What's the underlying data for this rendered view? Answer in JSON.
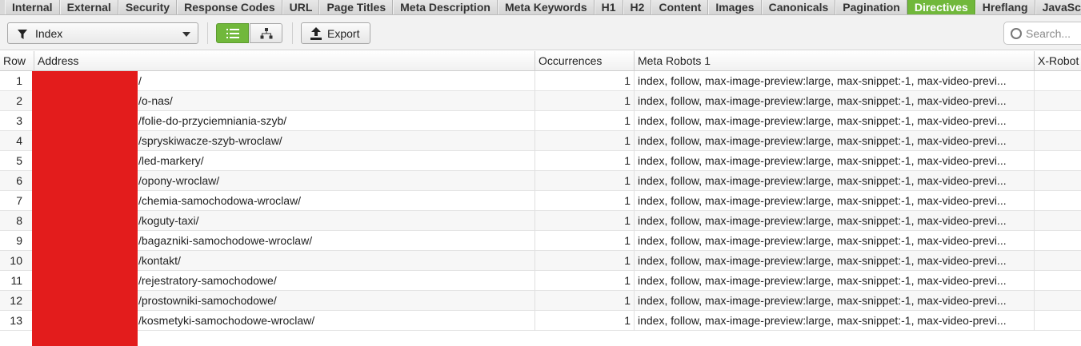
{
  "tabs": [
    {
      "label": "Internal"
    },
    {
      "label": "External"
    },
    {
      "label": "Security"
    },
    {
      "label": "Response Codes"
    },
    {
      "label": "URL"
    },
    {
      "label": "Page Titles"
    },
    {
      "label": "Meta Description"
    },
    {
      "label": "Meta Keywords"
    },
    {
      "label": "H1"
    },
    {
      "label": "H2"
    },
    {
      "label": "Content"
    },
    {
      "label": "Images"
    },
    {
      "label": "Canonicals"
    },
    {
      "label": "Pagination"
    },
    {
      "label": "Directives",
      "active": true
    },
    {
      "label": "Hreflang"
    },
    {
      "label": "JavaScri"
    }
  ],
  "toolbar": {
    "filter": {
      "value": "Index",
      "icon": "filter-icon"
    },
    "view_list": {
      "icon": "list-view-icon",
      "active": true
    },
    "view_tree": {
      "icon": "tree-view-icon",
      "active": false
    },
    "export_label": "Export",
    "export_icon": "upload-icon",
    "search": {
      "placeholder": "Search...",
      "icon": "search-icon"
    }
  },
  "table": {
    "columns": [
      "Row",
      "Address",
      "Occurrences",
      "Meta Robots 1",
      "X-Robot"
    ],
    "rows": [
      {
        "row": "1",
        "address": "/",
        "occurrences": "1",
        "meta_robots": "index, follow, max-image-preview:large, max-snippet:-1, max-video-previ..."
      },
      {
        "row": "2",
        "address": "/o-nas/",
        "occurrences": "1",
        "meta_robots": "index, follow, max-image-preview:large, max-snippet:-1, max-video-previ..."
      },
      {
        "row": "3",
        "address": "/folie-do-przyciemniania-szyb/",
        "occurrences": "1",
        "meta_robots": "index, follow, max-image-preview:large, max-snippet:-1, max-video-previ..."
      },
      {
        "row": "4",
        "address": "/spryskiwacze-szyb-wroclaw/",
        "occurrences": "1",
        "meta_robots": "index, follow, max-image-preview:large, max-snippet:-1, max-video-previ..."
      },
      {
        "row": "5",
        "address": "/led-markery/",
        "occurrences": "1",
        "meta_robots": "index, follow, max-image-preview:large, max-snippet:-1, max-video-previ..."
      },
      {
        "row": "6",
        "address": "/opony-wroclaw/",
        "occurrences": "1",
        "meta_robots": "index, follow, max-image-preview:large, max-snippet:-1, max-video-previ..."
      },
      {
        "row": "7",
        "address": "/chemia-samochodowa-wroclaw/",
        "occurrences": "1",
        "meta_robots": "index, follow, max-image-preview:large, max-snippet:-1, max-video-previ..."
      },
      {
        "row": "8",
        "address": "/koguty-taxi/",
        "occurrences": "1",
        "meta_robots": "index, follow, max-image-preview:large, max-snippet:-1, max-video-previ..."
      },
      {
        "row": "9",
        "address": "/bagazniki-samochodowe-wroclaw/",
        "occurrences": "1",
        "meta_robots": "index, follow, max-image-preview:large, max-snippet:-1, max-video-previ..."
      },
      {
        "row": "10",
        "address": "/kontakt/",
        "occurrences": "1",
        "meta_robots": "index, follow, max-image-preview:large, max-snippet:-1, max-video-previ..."
      },
      {
        "row": "11",
        "address": "/rejestratory-samochodowe/",
        "occurrences": "1",
        "meta_robots": "index, follow, max-image-preview:large, max-snippet:-1, max-video-previ..."
      },
      {
        "row": "12",
        "address": "/prostowniki-samochodowe/",
        "occurrences": "1",
        "meta_robots": "index, follow, max-image-preview:large, max-snippet:-1, max-video-previ..."
      },
      {
        "row": "13",
        "address": "/kosmetyki-samochodowe-wroclaw/",
        "occurrences": "1",
        "meta_robots": "index, follow, max-image-preview:large, max-snippet:-1, max-video-previ..."
      }
    ]
  },
  "colors": {
    "accent": "#71b83b",
    "redaction": "#e31c1c"
  }
}
